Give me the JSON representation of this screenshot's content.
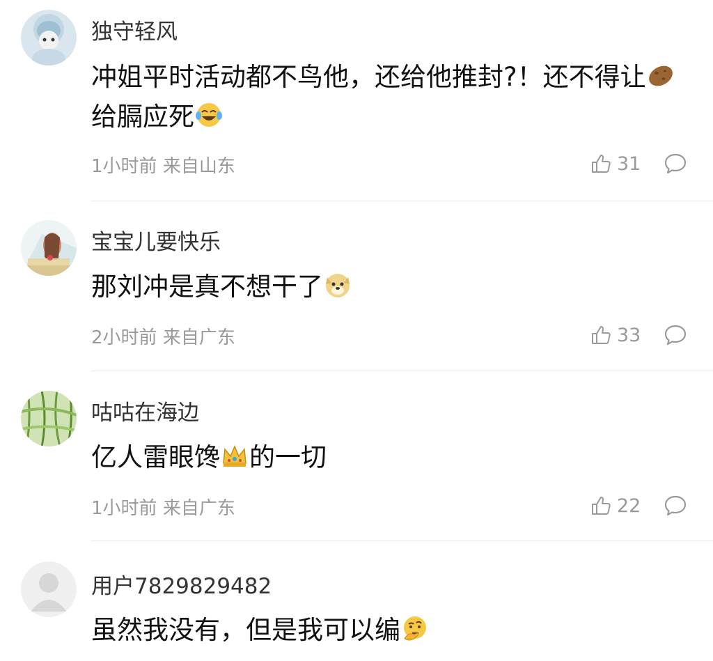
{
  "comments": [
    {
      "username": "独守轻风",
      "text_parts": [
        "冲姐平时活动都不鸟他，还给他推封?！还不得让",
        "给膈应死"
      ],
      "emojis": [
        "potato-emoji",
        "laugh-tears-emoji"
      ],
      "time": "1小时前",
      "location": "来自山东",
      "likes": "31"
    },
    {
      "username": "宝宝儿要快乐",
      "text_parts": [
        "那刘冲是真不想干了"
      ],
      "emojis": [
        "doge-emoji"
      ],
      "time": "2小时前",
      "location": "来自广东",
      "likes": "33"
    },
    {
      "username": "咕咕在海边",
      "text_parts": [
        "亿人雷眼馋",
        "的一切"
      ],
      "emojis": [
        "crown-emoji"
      ],
      "time": "1小时前",
      "location": "来自广东",
      "likes": "22"
    },
    {
      "username": "用户7829829482",
      "text_parts": [
        "虽然我没有，但是我可以编"
      ],
      "emojis": [
        "thinking-face-emoji"
      ]
    }
  ],
  "icons": {
    "like": "thumbs-up-icon",
    "reply": "comment-bubble-icon"
  },
  "colors": {
    "meta_gray": "#9a9a9a",
    "text": "#111111",
    "name": "#333333"
  }
}
